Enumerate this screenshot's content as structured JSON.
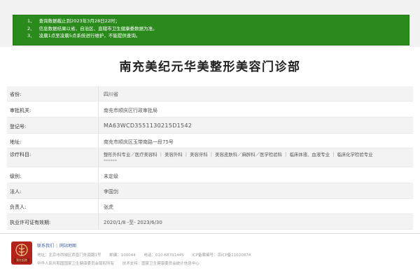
{
  "notice": {
    "lines": [
      {
        "num": "1、",
        "text": "查询数据截止到2023年3月28日22时；"
      },
      {
        "num": "2、",
        "text": "信息数据结果以省、自治区、直辖市卫生健康委数据为准。"
      },
      {
        "num": "3、",
        "text": "凌晨1点至凌晨5点系统进行维护，不能提供查询。"
      }
    ]
  },
  "page": {
    "title": "南充美纪元华美整形美容门诊部"
  },
  "details": [
    {
      "label": "省份:",
      "value": "四川省"
    },
    {
      "label": "审批机关:",
      "value": "南充市顺庆区行政审批局"
    },
    {
      "label": "登记号:",
      "value": "MA63WCD3551130215D1542"
    },
    {
      "label": "地址:",
      "value": "南充市顺庆区玉带南路一段75号"
    },
    {
      "label": "诊疗科目:",
      "value": "整形外科专业／医疗美容科 ｜ 美容外科 ｜ 美容牙科 ｜ 美容皮肤科／麻醉科／医学检验科 ｜ 临床体液、血液专业 ｜ 临床化学检验专业",
      "extra": "******"
    },
    {
      "label": "级别:",
      "value": "未定级"
    },
    {
      "label": "法人:",
      "value": "李国剑"
    },
    {
      "label": "负责人:",
      "value": "张虎"
    },
    {
      "label": "执业许可证有效期:",
      "value": "2020/1/8 -至- 2023/6/30"
    }
  ],
  "footer": {
    "logo_text": "我在起跑",
    "links": [
      "联系我们",
      "网站地图"
    ],
    "address_label": "地址：北京市西城区西直门外南路1号",
    "postcode": "邮编：100044",
    "phone": "电话：010-68791445",
    "icp": "ICP备案编号：京ICP备11020874",
    "copyright": "中华人民共和国国家卫生健康委员会版权所有",
    "support": "技术支持：国家卫生健康委员会统计信息中心"
  }
}
